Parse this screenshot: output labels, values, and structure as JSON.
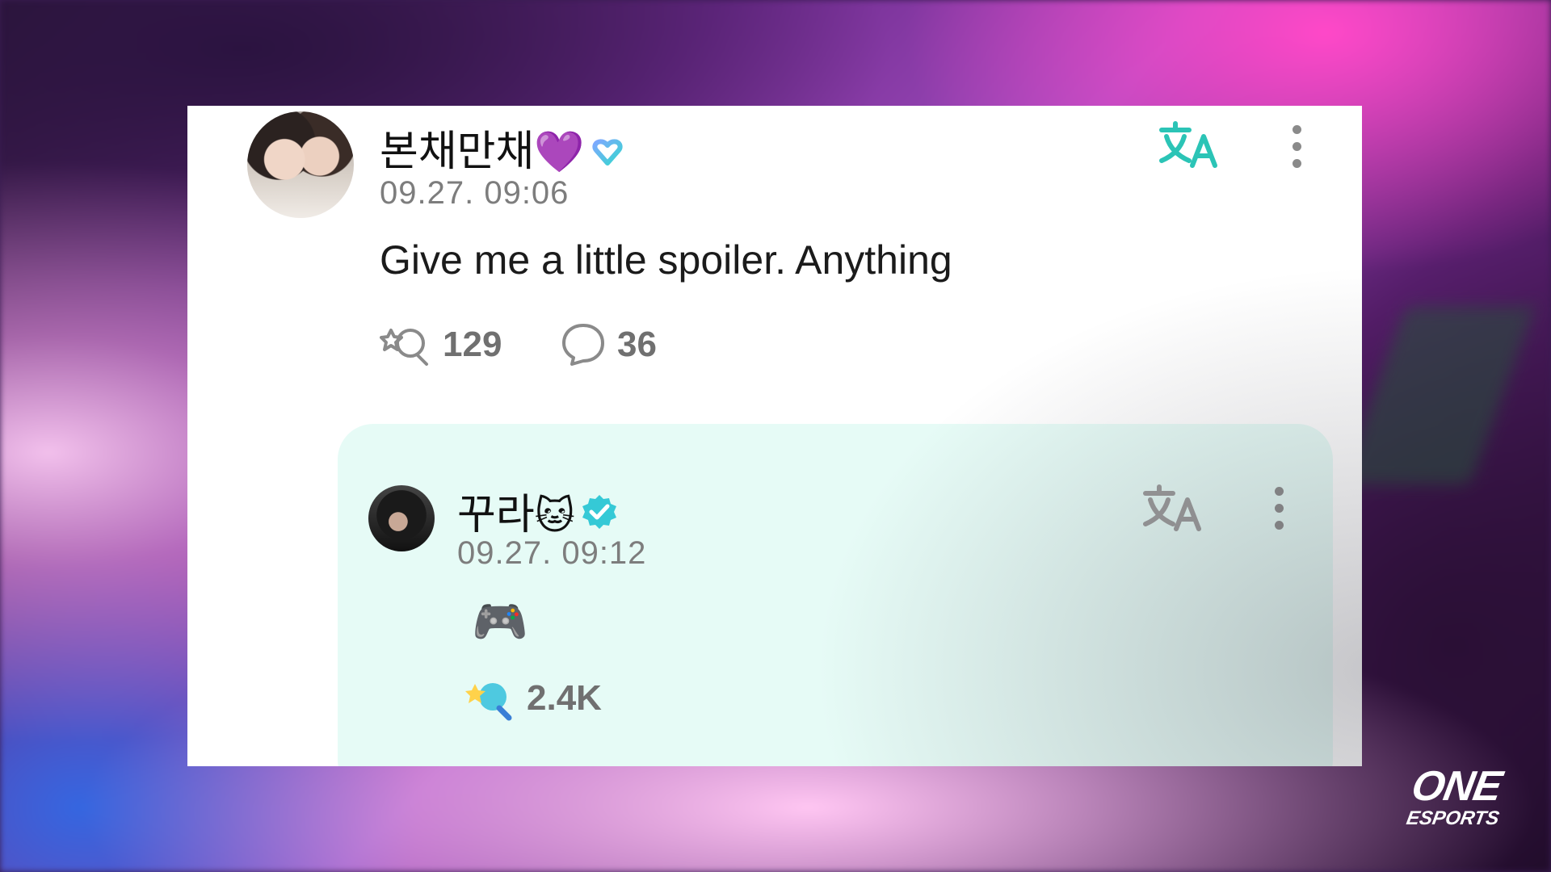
{
  "post": {
    "author": "본채만채",
    "author_emoji": "💜",
    "timestamp": "09.27. 09:06",
    "text": "Give me a little spoiler. Anything",
    "likes": "129",
    "comments": "36"
  },
  "reply": {
    "author": "꾸라",
    "author_emoji": "🐱",
    "timestamp": "09.27. 09:12",
    "body_emoji": "🎮",
    "likes": "2.4K"
  },
  "watermark": {
    "line1": "ONE",
    "line2": "ESPORTS"
  },
  "colors": {
    "accent_teal": "#2bc4b6",
    "reply_bg": "#e6fbf6",
    "verified": "#35c9d6",
    "heart": "#8a3cd6"
  }
}
